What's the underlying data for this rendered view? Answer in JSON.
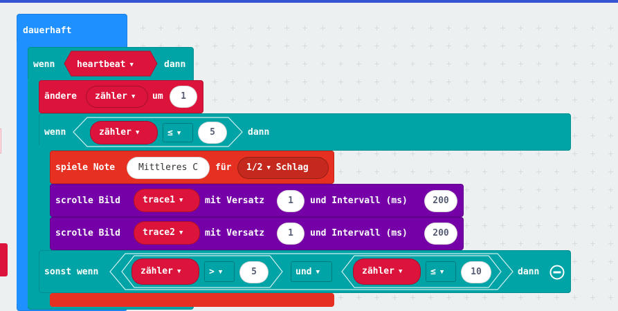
{
  "forever": {
    "label": "dauerhaft"
  },
  "if_block": {
    "label_if": "wenn",
    "condition": "heartbeat",
    "label_then": "dann"
  },
  "change": {
    "label": "ändere",
    "variable": "zähler",
    "label_by": "um",
    "value": "1"
  },
  "if_inner": {
    "label_if": "wenn",
    "variable": "zähler",
    "operator": "≤",
    "value": "5",
    "label_then": "dann"
  },
  "play_tone": {
    "label": "spiele Note",
    "note": "Mittleres C",
    "label_for": "für",
    "beat": "1/2",
    "beat_unit": "Schlag"
  },
  "scroll1": {
    "label": "scrolle Bild",
    "image": "trace1",
    "label_offset": "mit Versatz",
    "offset": "1",
    "label_interval": "und Intervall (ms)",
    "interval": "200"
  },
  "scroll2": {
    "label": "scrolle Bild",
    "image": "trace2",
    "label_offset": "mit Versatz",
    "offset": "1",
    "label_interval": "und Intervall (ms)",
    "interval": "200"
  },
  "else_if": {
    "label": "sonst wenn",
    "left_variable": "zähler",
    "left_operator": ">",
    "left_value": "5",
    "logic": "und",
    "right_variable": "zähler",
    "right_operator": "≤",
    "right_value": "10",
    "label_then": "dann"
  },
  "colors": {
    "loops": "#1e90ff",
    "logic": "#00a4a6",
    "variables": "#dc143c",
    "music": "#e63022",
    "led": "#7600a8"
  }
}
